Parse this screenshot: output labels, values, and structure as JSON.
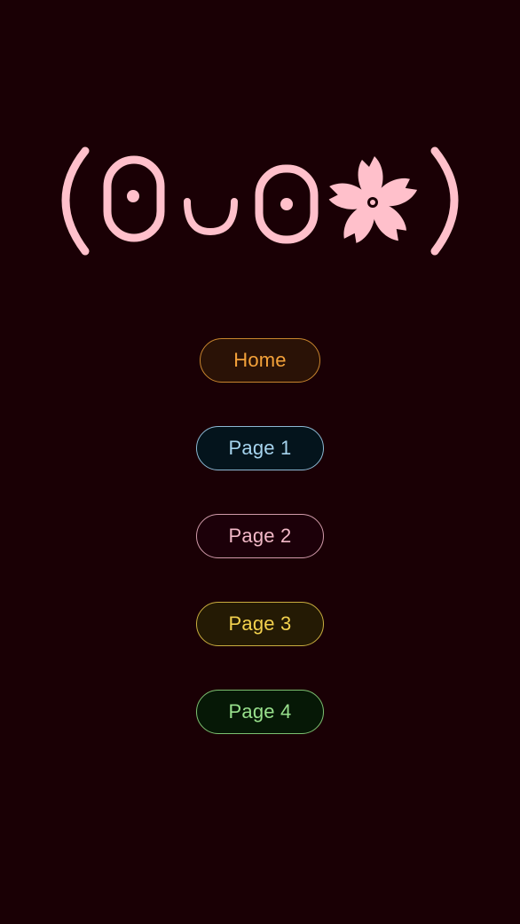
{
  "header": {
    "kaomoji": "(ʘᴗʘ✿)",
    "color": "#ffc0cb"
  },
  "nav": {
    "home_label": "Home",
    "page1_label": "Page 1",
    "page2_label": "Page 2",
    "page3_label": "Page 3",
    "page4_label": "Page 4"
  },
  "colors": {
    "background": "#1a0005",
    "home": "#f4a23a",
    "page1": "#a6d4ee",
    "page2": "#f2b9c7",
    "page3": "#f3d14e",
    "page4": "#98e08c"
  }
}
